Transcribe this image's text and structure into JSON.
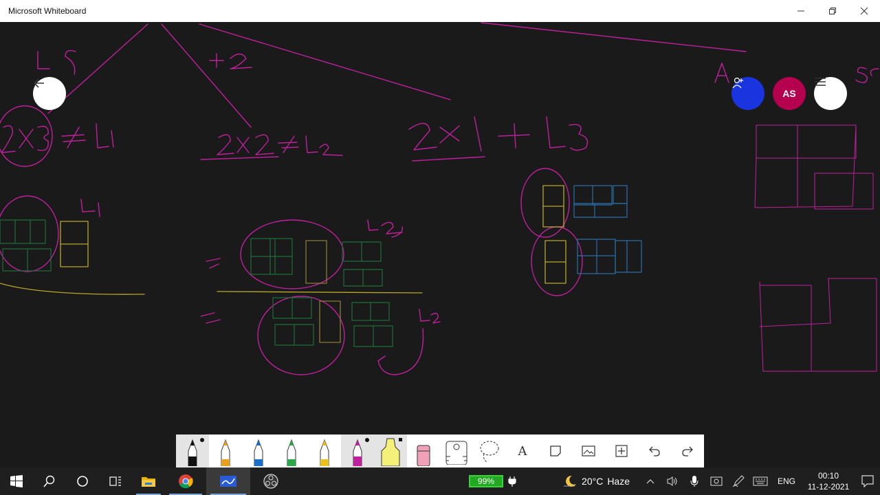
{
  "window": {
    "title": "Microsoft Whiteboard",
    "controls": [
      "minimize",
      "restore",
      "close"
    ]
  },
  "canvas": {
    "background": "#1a1a1a",
    "ink_colors": {
      "magenta": "#c0209e",
      "green": "#1e6e3a",
      "yellow": "#b9a82a",
      "blue": "#2a6fa8"
    },
    "handwriting": [
      "2x3 ≠ L1",
      "2x2 ≠ L2",
      "2x1 ≠ L3",
      "+2",
      "L1",
      "L2",
      "L2"
    ]
  },
  "header": {
    "back_icon": "arrow-left-icon",
    "invite_icon": "person-add-icon",
    "avatar_initials": "AS",
    "menu_icon": "hamburger-icon",
    "invite_color": "#1a35e0",
    "avatar_color": "#b5004f"
  },
  "toolbar": {
    "tools": [
      {
        "name": "black-pen",
        "color": "#111111",
        "active": true
      },
      {
        "name": "orange-pen",
        "color": "#e8a020",
        "active": false
      },
      {
        "name": "blue-pen",
        "color": "#1a6fc8",
        "active": false
      },
      {
        "name": "green-pen",
        "color": "#2aa84a",
        "active": false
      },
      {
        "name": "yellow-pen",
        "color": "#e8c020",
        "active": false
      },
      {
        "name": "magenta-pen",
        "color": "#c0209e",
        "active": true
      },
      {
        "name": "highlighter",
        "color": "#f4f07a",
        "active": true
      },
      {
        "name": "eraser",
        "color": "#f0a0b8",
        "active": false
      },
      {
        "name": "ruler",
        "active": false
      },
      {
        "name": "lasso",
        "active": false
      },
      {
        "name": "text",
        "label": "A"
      },
      {
        "name": "note"
      },
      {
        "name": "image"
      },
      {
        "name": "insert"
      },
      {
        "name": "undo"
      },
      {
        "name": "redo"
      }
    ]
  },
  "taskbar": {
    "apps": [
      "start-icon",
      "search-icon",
      "cortana-icon",
      "task-view-icon",
      "file-explorer-icon",
      "chrome-icon",
      "whiteboard-icon",
      "obs-icon"
    ],
    "battery": "99%",
    "temperature": "20°C",
    "weather": "Haze",
    "language": "ENG",
    "time": "00:10",
    "date": "11-12-2021"
  }
}
